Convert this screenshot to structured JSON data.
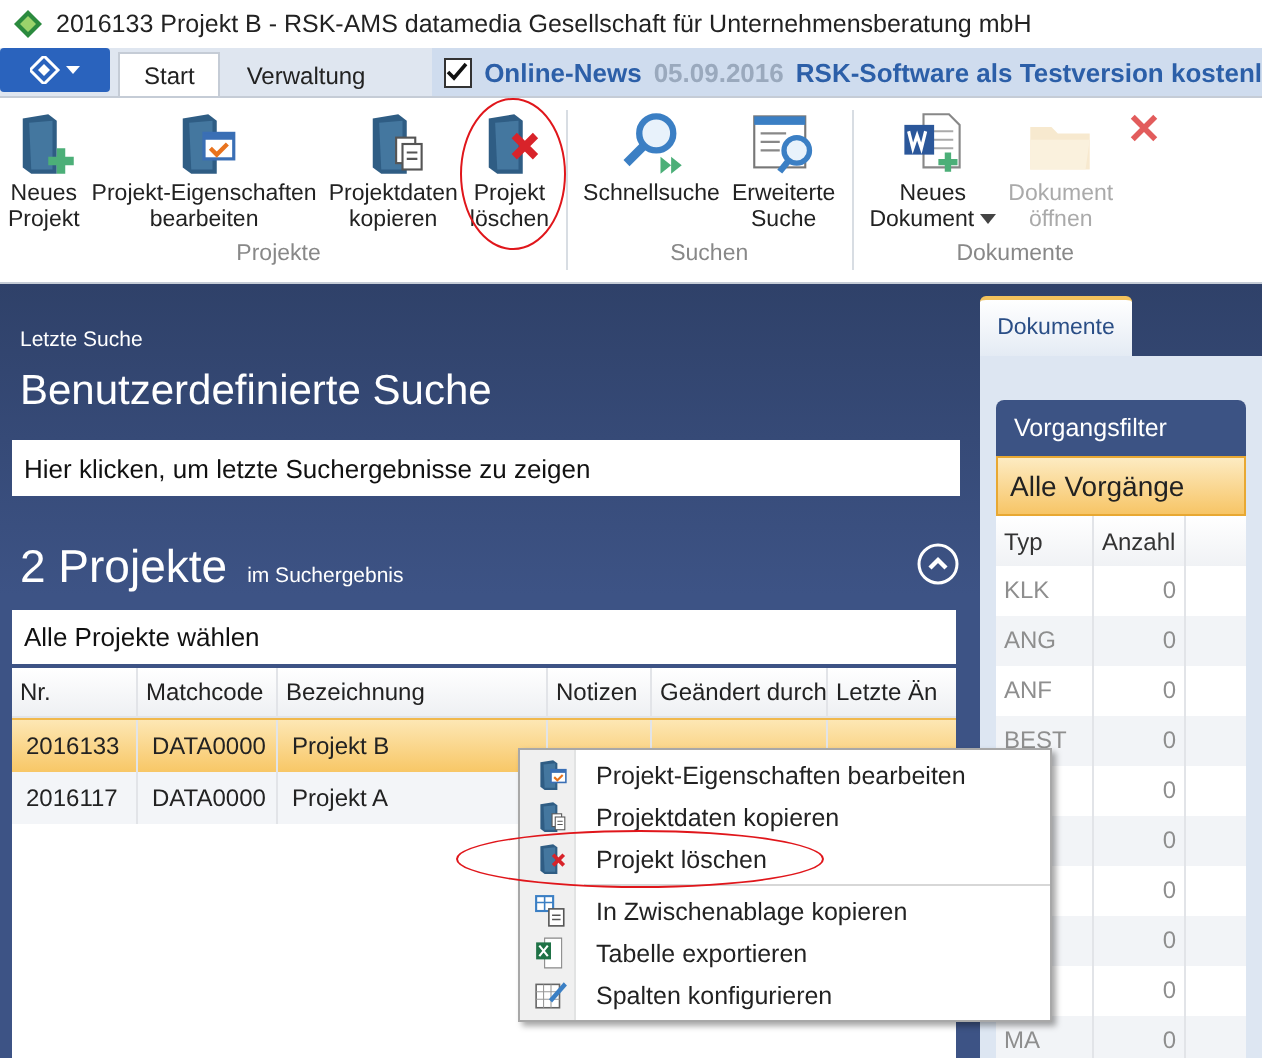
{
  "window": {
    "title": "2016133 Projekt B - RSK-AMS  datamedia Gesellschaft für Unternehmensberatung mbH"
  },
  "ribbon_tabs": [
    {
      "label": "Start",
      "selected": true
    },
    {
      "label": "Verwaltung",
      "selected": false
    }
  ],
  "news": {
    "checked": true,
    "label": "Online-News",
    "date": "05.09.2016",
    "text": "RSK-Software als Testversion kostenl"
  },
  "ribbon_groups": [
    {
      "label": "Projekte",
      "buttons": [
        {
          "kind": "book-plus",
          "lines": [
            "Neues",
            "Projekt"
          ],
          "disabled": false,
          "dropdown": false,
          "circled": false
        },
        {
          "kind": "book-window",
          "lines": [
            "Projekt-Eigenschaften",
            "bearbeiten"
          ],
          "disabled": false,
          "dropdown": false,
          "circled": false
        },
        {
          "kind": "book-docs",
          "lines": [
            "Projektdaten",
            "kopieren"
          ],
          "disabled": false,
          "dropdown": false,
          "circled": false
        },
        {
          "kind": "book-x",
          "lines": [
            "Projekt",
            "löschen"
          ],
          "disabled": false,
          "dropdown": false,
          "circled": true
        }
      ]
    },
    {
      "label": "Suchen",
      "buttons": [
        {
          "kind": "search-arrow",
          "lines": [
            "Schnellsuche"
          ],
          "disabled": false,
          "dropdown": false,
          "circled": false
        },
        {
          "kind": "search-window",
          "lines": [
            "Erweiterte",
            "Suche"
          ],
          "disabled": false,
          "dropdown": false,
          "circled": false
        }
      ]
    },
    {
      "label": "Dokumente",
      "buttons": [
        {
          "kind": "word-plus",
          "lines": [
            "Neues",
            "Dokument"
          ],
          "disabled": false,
          "dropdown": true,
          "circled": false
        },
        {
          "kind": "folder",
          "lines": [
            "Dokument",
            "öffnen"
          ],
          "disabled": true,
          "dropdown": false,
          "circled": false
        },
        {
          "kind": "x",
          "disabled": false,
          "dropdown": false,
          "circled": false
        }
      ]
    }
  ],
  "search": {
    "caption": "Letzte Suche",
    "title": "Benutzerdefinierte Suche",
    "field_value": "Hier klicken, um letzte Suchergebnisse zu zeigen"
  },
  "results": {
    "count": "2 Projekte",
    "suffix": "im Suchergebnis",
    "select_all": "Alle Projekte wählen"
  },
  "table": {
    "columns": [
      "Nr.",
      "Matchcode",
      "Bezeichnung",
      "Notizen",
      "Geändert durch",
      "Letzte Än"
    ],
    "rows": [
      {
        "cells": [
          "2016133",
          "DATA0000",
          "Projekt B"
        ],
        "selected": true
      },
      {
        "cells": [
          "2016117",
          "DATA0000",
          "Projekt A"
        ],
        "selected": false
      }
    ]
  },
  "context_menu": [
    {
      "items": [
        {
          "kind": "book-window",
          "label": "Projekt-Eigenschaften bearbeiten",
          "circled": false
        },
        {
          "kind": "book-docs",
          "label": "Projektdaten kopieren",
          "circled": false
        },
        {
          "kind": "book-x",
          "label": "Projekt löschen",
          "circled": true
        }
      ]
    },
    {
      "items": [
        {
          "kind": "copy-table",
          "label": "In Zwischenablage kopieren",
          "circled": false
        },
        {
          "kind": "excel",
          "label": "Tabelle exportieren",
          "circled": false
        },
        {
          "kind": "table-edit",
          "label": "Spalten konfigurieren",
          "circled": false
        }
      ]
    }
  ],
  "side_panel": {
    "tab": "Dokumente",
    "filter_title": "Vorgangsfilter",
    "filter_selected": "Alle Vorgänge",
    "columns": [
      "Typ",
      "Anzahl"
    ],
    "rows": [
      {
        "type": "KLK",
        "count": "0"
      },
      {
        "type": "ANG",
        "count": "0"
      },
      {
        "type": "ANF",
        "count": "0"
      },
      {
        "type": "BEST",
        "count": "0"
      },
      {
        "count": "0"
      },
      {
        "count": "0"
      },
      {
        "count": "0"
      },
      {
        "count": "0"
      },
      {
        "count": "0"
      },
      {
        "type": "MA",
        "count": "0"
      }
    ]
  }
}
